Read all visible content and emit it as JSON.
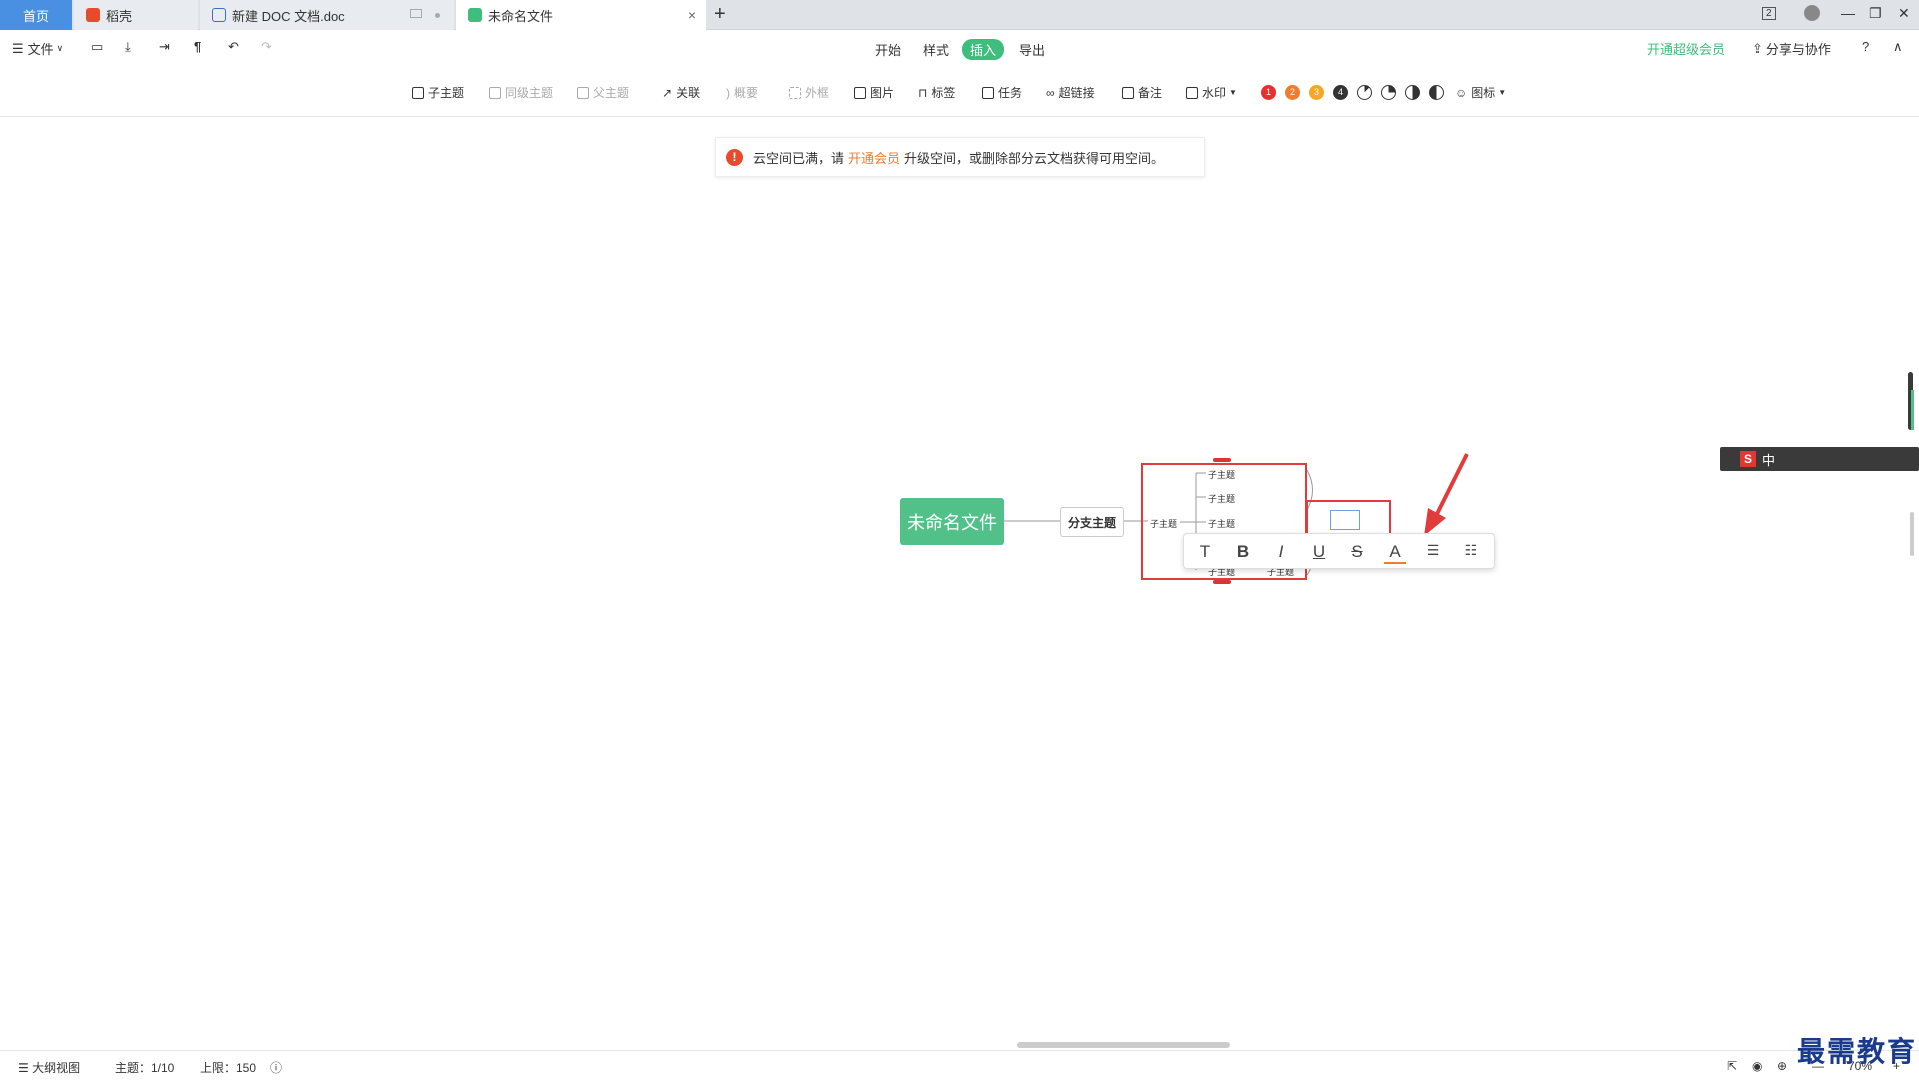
{
  "tabs": {
    "home": "首页",
    "tab1": "稻壳",
    "tab2": "新建 DOC 文档.doc",
    "tab3": "未命名文件",
    "close": "×",
    "new_tab": "+"
  },
  "window": {
    "badge": "2",
    "minimize": "—",
    "restore": "❐",
    "close": "✕"
  },
  "toolbar": {
    "file": "文件",
    "menu_tabs": [
      "开始",
      "样式",
      "插入",
      "导出"
    ],
    "active_tab": "插入",
    "vip": "开通超级会员",
    "share": "分享与协作",
    "help": "?"
  },
  "ribbon": {
    "child_topic": "子主题",
    "sibling_topic": "同级主题",
    "parent_topic": "父主题",
    "relation": "关联",
    "summary": "概要",
    "frame": "外框",
    "image": "图片",
    "tag": "标签",
    "task": "任务",
    "hyperlink": "超链接",
    "note": "备注",
    "watermark": "水印",
    "priorities": [
      "1",
      "2",
      "3",
      "4"
    ],
    "priority_colors": [
      "#e8302e",
      "#f07c2c",
      "#f5a623",
      "#333333"
    ],
    "icons": "图标"
  },
  "notice": {
    "prefix": "云空间已满，请",
    "link": "开通会员",
    "suffix": "升级空间，或删除部分云文档获得可用空间。"
  },
  "mindmap": {
    "root": "未命名文件",
    "branch": "分支主题",
    "level2": "子主题",
    "subtopics": [
      "子主题",
      "子主题",
      "子主题"
    ],
    "bottom": [
      "子主题",
      "子主题"
    ]
  },
  "format_bar": [
    "T",
    "B",
    "I",
    "U",
    "S",
    "A",
    "☰",
    "☷"
  ],
  "ime": {
    "logo": "S",
    "mode": "中"
  },
  "status": {
    "outline": "大纲视图",
    "topics": "主题：1/10",
    "limit": "上限：150",
    "zoom": "70%"
  },
  "watermark": "最需教育",
  "colors": {
    "accent": "#3ebd7c",
    "root": "#52c189",
    "highlight": "#e23b3b"
  }
}
